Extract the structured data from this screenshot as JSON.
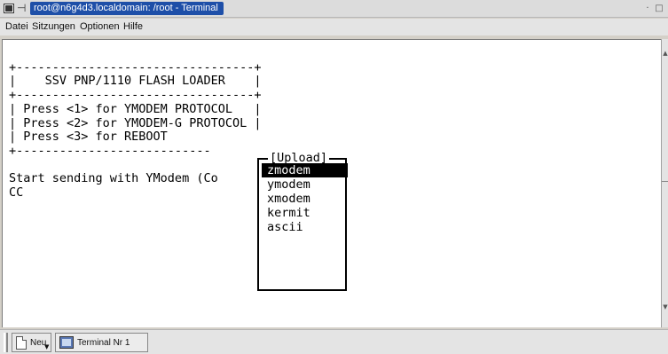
{
  "window": {
    "title": "root@n6g4d3.localdomain: /root - Terminal",
    "controls": {
      "minimize": "·",
      "maximize": "□",
      "close": "×"
    }
  },
  "menubar": {
    "items": [
      "Datei",
      "Sitzungen",
      "Optionen",
      "Hilfe"
    ]
  },
  "terminal": {
    "text": "\n+---------------------------------+\n|    SSV PNP/1110 FLASH LOADER    |\n+---------------------------------+\n| Press <1> for YMODEM PROTOCOL   |\n| Press <2> for YMODEM-G PROTOCOL |\n| Press <3> for REBOOT\n+---------------------------\n\nStart sending with YModem (Co          it)....\nCC"
  },
  "upload_menu": {
    "title": "[Upload]",
    "options": [
      "zmodem",
      "ymodem",
      "xmodem",
      "kermit",
      "ascii"
    ],
    "selected": "zmodem"
  },
  "taskbar": {
    "new_button": "Neu",
    "tabs": [
      "Terminal Nr 1"
    ]
  },
  "icons": {
    "window_menu": "window-menu-icon",
    "sticky": "pin-icon",
    "new_session": "new-document-icon",
    "terminal_tab": "terminal-icon"
  },
  "colors": {
    "title_active": "#1e4fa8",
    "terminal_bg": "#ffffff",
    "selection_bg": "#000000"
  }
}
